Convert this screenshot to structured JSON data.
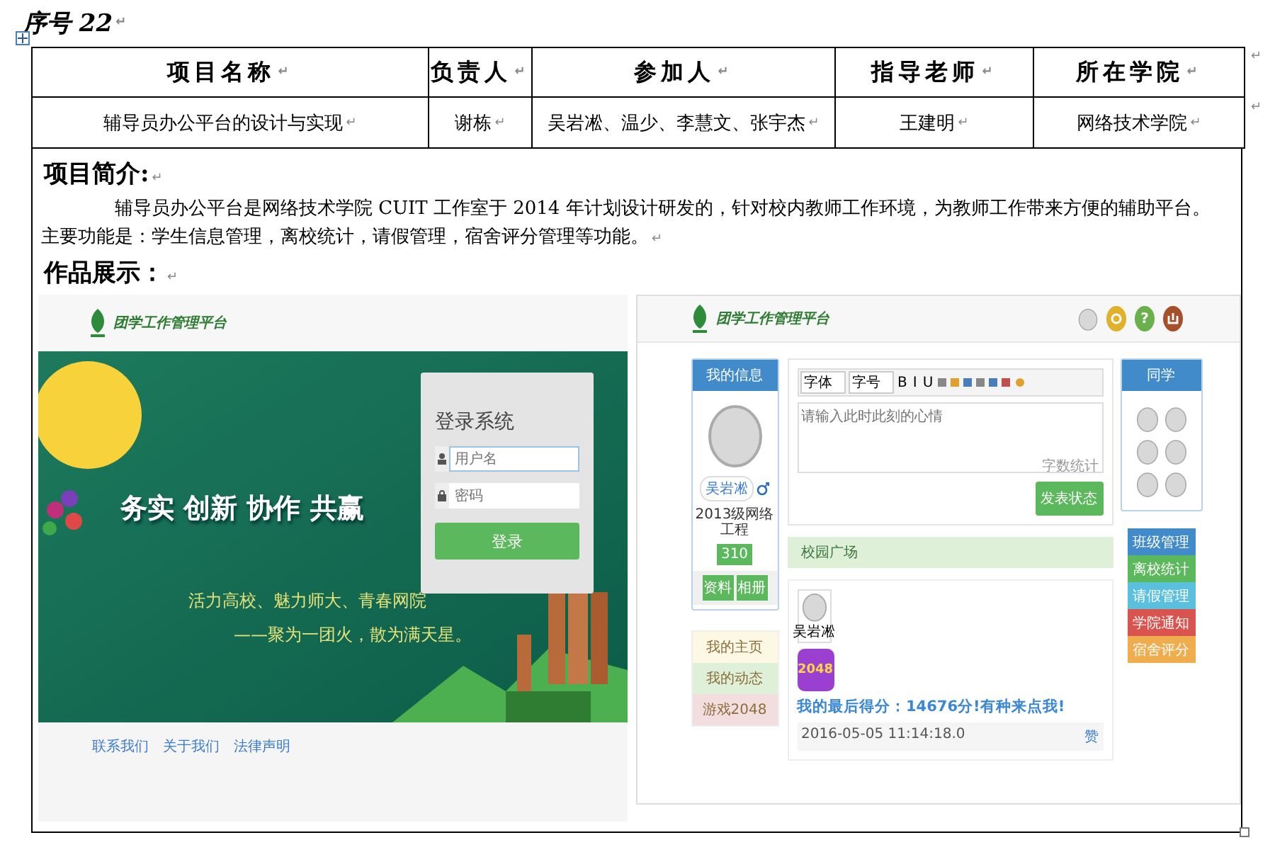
{
  "para_mark": "↵",
  "heading": "序号 22",
  "table": {
    "columns": [
      "项目名称",
      "负责人",
      "参加人",
      "指导老师",
      "所在学院"
    ],
    "rows": [
      [
        "辅导员办公平台的设计与实现",
        "谢栋",
        "吴岩凇、温少、李慧文、张宇杰",
        "王建明",
        "网络技术学院"
      ]
    ]
  },
  "intro": {
    "title": "项目简介:",
    "text": "辅导员办公平台是网络技术学院 CUIT 工作室于 2014 年计划设计研发的，针对校内教师工作环境，为教师工作带来方便的辅助平台。主要功能是：学生信息管理，离校统计，请假管理，宿舍评分管理等功能。"
  },
  "showcase": {
    "title": "作品展示："
  },
  "login_screen": {
    "logo": "团学工作管理平台",
    "slogan": "务实 创新 协作 共赢",
    "motto": "活力高校、魅力师大、青春网院",
    "motto_line2": "——聚为一团火，散为满天星。",
    "login": {
      "title": "登录系统",
      "username": {
        "placeholder": "用户名"
      },
      "password": {
        "placeholder": "密码"
      },
      "button": "登录"
    },
    "footer_links": [
      "联系我们",
      "关于我们",
      "法律声明"
    ]
  },
  "home_screen": {
    "logo": "团学工作管理平台",
    "header_icons": [
      {
        "kind": "avatar"
      },
      {
        "kind": "ring"
      },
      {
        "kind": "help",
        "glyph": "?"
      },
      {
        "kind": "power"
      }
    ],
    "profile": {
      "title": "我的信息",
      "name": "吴岩凇",
      "class": "2013级网络工程",
      "badge": "310",
      "buttons": [
        "资料",
        "相册"
      ]
    },
    "menu": [
      {
        "label": "我的主页",
        "color": "#fcf8e3"
      },
      {
        "label": "我的动态",
        "color": "#dff0d8"
      },
      {
        "label": "游戏2048",
        "color": "#f2dede"
      }
    ],
    "editor": {
      "selects": [
        "字体",
        "字号"
      ],
      "format_buttons": [
        "B",
        "I",
        "U"
      ],
      "placeholder": "请输入此时此刻的心情",
      "counter": "字数统计",
      "button": "发表状态"
    },
    "feed_title": "校园广场",
    "post": {
      "author": "吴岩凇",
      "game_icon": "2048",
      "text": "我的最后得分：14676分!有种来点我!",
      "time": "2016-05-05 11:14:18.0",
      "like": "赞"
    },
    "friends": {
      "title": "同学"
    },
    "actions": [
      {
        "label": "班级管理",
        "color": "#428bca"
      },
      {
        "label": "离校统计",
        "color": "#5cb85c"
      },
      {
        "label": "请假管理",
        "color": "#5bc0de"
      },
      {
        "label": "学院通知",
        "color": "#d9534f"
      },
      {
        "label": "宿舍评分",
        "color": "#f0ad4e"
      }
    ]
  }
}
